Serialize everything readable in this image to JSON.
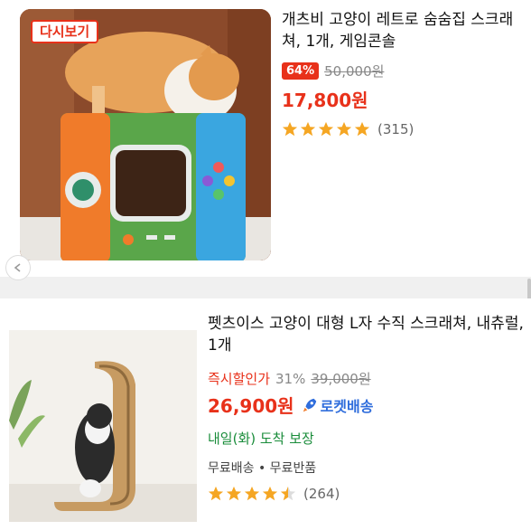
{
  "products": [
    {
      "rebuy_label": "다시보기",
      "title": "개츠비 고양이 레트로 숨숨집 스크래쳐, 1개, 게임콘솔",
      "discount": "64%",
      "original_price": "50,000원",
      "sale_price": "17,800원",
      "rating": 5,
      "review_count": "(315)",
      "icon": "carousel-indicator-icon"
    },
    {
      "title": "펫츠이스 고양이 대형 L자 수직 스크래쳐, 내츄럴, 1개",
      "instant_discount_label": "즉시할인가",
      "discount": "31%",
      "original_price": "39,000원",
      "sale_price": "26,900원",
      "rocket_label": "로켓배송",
      "delivery": "내일(화) 도착 보장",
      "shipping": "무료배송 • 무료반품",
      "rating": 4.5,
      "review_count": "(264)"
    }
  ],
  "colors": {
    "accent": "#e8311a",
    "rocket": "#2f6ddc",
    "delivery": "#198c3a",
    "star": "#f5a623"
  }
}
